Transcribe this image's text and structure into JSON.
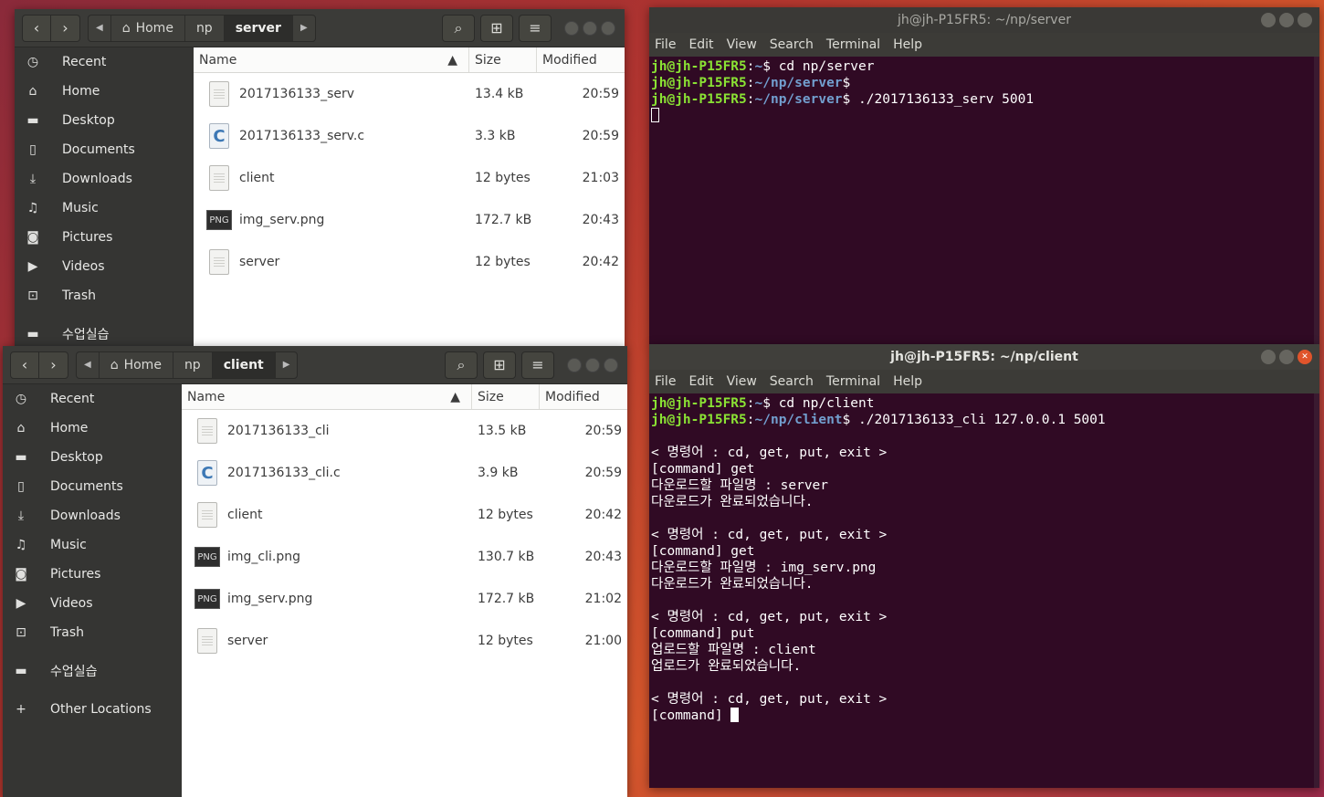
{
  "fm_top": {
    "path": {
      "home": "Home",
      "np": "np",
      "current": "server"
    },
    "sidebar": [
      {
        "icon": "clock-icon",
        "glyph": "◷",
        "label": "Recent"
      },
      {
        "icon": "home-icon",
        "glyph": "⌂",
        "label": "Home"
      },
      {
        "icon": "folder-icon",
        "glyph": "▬",
        "label": "Desktop"
      },
      {
        "icon": "document-icon",
        "glyph": "▯",
        "label": "Documents"
      },
      {
        "icon": "download-icon",
        "glyph": "⤓",
        "label": "Downloads"
      },
      {
        "icon": "music-icon",
        "glyph": "♫",
        "label": "Music"
      },
      {
        "icon": "camera-icon",
        "glyph": "◙",
        "label": "Pictures"
      },
      {
        "icon": "video-icon",
        "glyph": "▶",
        "label": "Videos"
      },
      {
        "icon": "trash-icon",
        "glyph": "⊡",
        "label": "Trash"
      }
    ],
    "bookmark": "수업실습",
    "columns": {
      "name": "Name",
      "size": "Size",
      "modified": "Modified"
    },
    "files": [
      {
        "type": "doc",
        "name": "2017136133_serv",
        "size": "13.4 kB",
        "modified": "20:59"
      },
      {
        "type": "c",
        "name": "2017136133_serv.c",
        "size": "3.3 kB",
        "modified": "20:59"
      },
      {
        "type": "doc",
        "name": "client",
        "size": "12 bytes",
        "modified": "21:03"
      },
      {
        "type": "png",
        "name": "img_serv.png",
        "size": "172.7 kB",
        "modified": "20:43"
      },
      {
        "type": "doc",
        "name": "server",
        "size": "12 bytes",
        "modified": "20:42"
      }
    ]
  },
  "fm_bottom": {
    "path": {
      "home": "Home",
      "np": "np",
      "current": "client"
    },
    "sidebar": [
      {
        "icon": "clock-icon",
        "glyph": "◷",
        "label": "Recent"
      },
      {
        "icon": "home-icon",
        "glyph": "⌂",
        "label": "Home"
      },
      {
        "icon": "folder-icon",
        "glyph": "▬",
        "label": "Desktop"
      },
      {
        "icon": "document-icon",
        "glyph": "▯",
        "label": "Documents"
      },
      {
        "icon": "download-icon",
        "glyph": "⤓",
        "label": "Downloads"
      },
      {
        "icon": "music-icon",
        "glyph": "♫",
        "label": "Music"
      },
      {
        "icon": "camera-icon",
        "glyph": "◙",
        "label": "Pictures"
      },
      {
        "icon": "video-icon",
        "glyph": "▶",
        "label": "Videos"
      },
      {
        "icon": "trash-icon",
        "glyph": "⊡",
        "label": "Trash"
      }
    ],
    "bookmark": "수업실습",
    "other_locations": "Other Locations",
    "columns": {
      "name": "Name",
      "size": "Size",
      "modified": "Modified"
    },
    "files": [
      {
        "type": "doc",
        "name": "2017136133_cli",
        "size": "13.5 kB",
        "modified": "20:59"
      },
      {
        "type": "c",
        "name": "2017136133_cli.c",
        "size": "3.9 kB",
        "modified": "20:59"
      },
      {
        "type": "doc",
        "name": "client",
        "size": "12 bytes",
        "modified": "20:42"
      },
      {
        "type": "png",
        "name": "img_cli.png",
        "size": "130.7 kB",
        "modified": "20:43"
      },
      {
        "type": "png",
        "name": "img_serv.png",
        "size": "172.7 kB",
        "modified": "21:02"
      },
      {
        "type": "doc",
        "name": "server",
        "size": "12 bytes",
        "modified": "21:00"
      }
    ]
  },
  "term_server": {
    "title": "jh@jh-P15FR5: ~/np/server",
    "menu": [
      "File",
      "Edit",
      "View",
      "Search",
      "Terminal",
      "Help"
    ],
    "lines": [
      {
        "user": "jh@jh-P15FR5",
        "path": "~",
        "cmd": "cd np/server"
      },
      {
        "user": "jh@jh-P15FR5",
        "path": "~/np/server",
        "cmd": ""
      },
      {
        "user": "jh@jh-P15FR5",
        "path": "~/np/server",
        "cmd": "./2017136133_serv 5001"
      }
    ]
  },
  "term_client": {
    "title": "jh@jh-P15FR5: ~/np/client",
    "menu": [
      "File",
      "Edit",
      "View",
      "Search",
      "Terminal",
      "Help"
    ],
    "prompts": [
      {
        "user": "jh@jh-P15FR5",
        "path": "~",
        "cmd": "cd np/client"
      },
      {
        "user": "jh@jh-P15FR5",
        "path": "~/np/client",
        "cmd": "./2017136133_cli 127.0.0.1 5001"
      }
    ],
    "output": [
      "",
      "< 명령어 : cd, get, put, exit >",
      "[command] get",
      "다운로드할 파일명 : server",
      "다운로드가 완료되었습니다.",
      "",
      "< 명령어 : cd, get, put, exit >",
      "[command] get",
      "다운로드할 파일명 : img_serv.png",
      "다운로드가 완료되었습니다.",
      "",
      "< 명령어 : cd, get, put, exit >",
      "[command] put",
      "업로드할 파일명 : client",
      "업로드가 완료되었습니다.",
      "",
      "< 명령어 : cd, get, put, exit >",
      "[command] "
    ]
  }
}
